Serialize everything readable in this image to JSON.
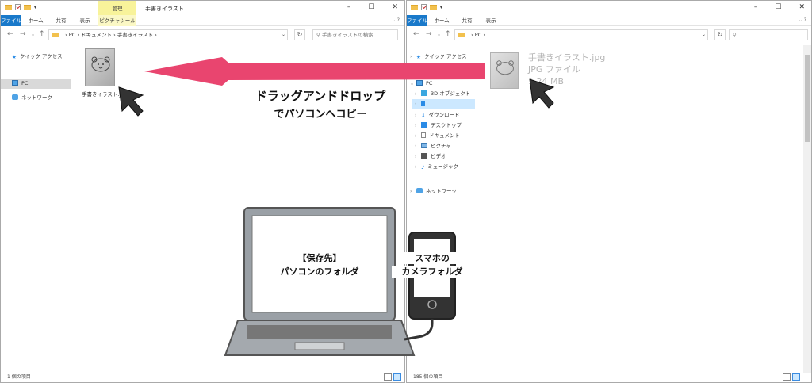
{
  "left_window": {
    "tab_manage": "管理",
    "title": "手書きイラスト",
    "ribbon_tabs": [
      "ファイル",
      "ホーム",
      "共有",
      "表示",
      "ピクチャツール"
    ],
    "address": [
      "PC",
      "ドキュメント",
      "手書きイラスト"
    ],
    "search_placeholder": "手書きイラストの検索",
    "nav": [
      "クイック アクセス",
      "PC",
      "ネットワーク"
    ],
    "file_name": "手書きイラスト.jpg",
    "status": "1 個の項目"
  },
  "right_window": {
    "ribbon_tabs": [
      "ファイル",
      "ホーム",
      "共有",
      "表示"
    ],
    "address": [
      "PC"
    ],
    "nav_quick": "クイック アクセス",
    "nav_pc": "PC",
    "nav_children": [
      "3D オブジェクト",
      "",
      "ダウンロード",
      "デスクトップ",
      "ドキュメント",
      "ピクチャ",
      "ビデオ",
      "ミュージック"
    ],
    "nav_network": "ネットワーク",
    "drag_file_name": "手書きイラスト.jpg",
    "drag_file_type": "JPG ファイル",
    "drag_file_size": "1.24 MB",
    "status": "185 個の項目"
  },
  "annotation": {
    "line1": "ドラッグアンドドロップ",
    "line2": "でパソコンへコピー",
    "arrow_color": "#e9456f"
  },
  "illustration": {
    "laptop_line1": "【保存先】",
    "laptop_line2": "パソコンのフォルダ",
    "phone_line1": "スマホの",
    "phone_line2": "カメラフォルダ"
  }
}
